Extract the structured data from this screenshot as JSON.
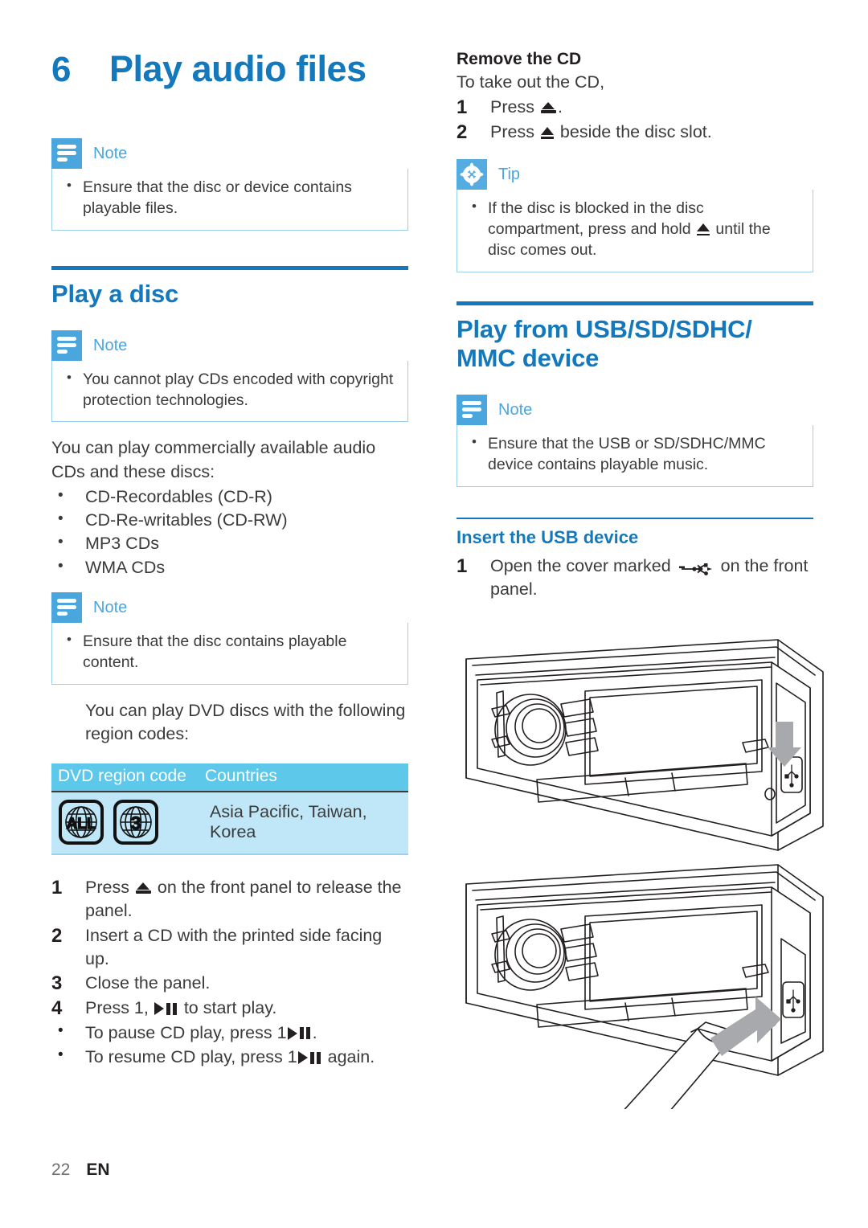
{
  "chapter": {
    "number": "6",
    "title": "Play audio files"
  },
  "left_column": {
    "note_intro": {
      "label": "Note",
      "items": [
        "Ensure that the disc or device contains playable files."
      ]
    },
    "play_a_disc": {
      "title": "Play a disc",
      "note_copyright": {
        "label": "Note",
        "items": [
          "You cannot play CDs encoded with copyright protection technologies."
        ]
      },
      "intro_paragraph": "You can play commercially available audio CDs and these discs:",
      "disc_types": [
        "CD-Recordables (CD-R)",
        "CD-Re-writables (CD-RW)",
        "MP3 CDs",
        "WMA CDs"
      ],
      "note_content": {
        "label": "Note",
        "items": [
          "Ensure that the disc contains playable content."
        ]
      },
      "dvd_paragraph": "You can play DVD discs with the following region codes:",
      "region_table": {
        "headers": [
          "DVD region code",
          "Countries"
        ],
        "rows": [
          {
            "codes": [
              "ALL",
              "3"
            ],
            "countries": "Asia Pacific, Taiwan, Korea"
          }
        ]
      },
      "steps": [
        {
          "num": "1",
          "text_before": "Press ",
          "symbol": "eject-solid",
          "text_after": " on the front panel to release the panel."
        },
        {
          "num": "2",
          "text_before": "Insert a CD with the printed side facing up.",
          "symbol": "",
          "text_after": ""
        },
        {
          "num": "3",
          "text_before": "Close the panel.",
          "symbol": "",
          "text_after": ""
        },
        {
          "num": "4",
          "text_before": "Press 1, ",
          "symbol": "play-pause",
          "text_after": " to start play."
        }
      ],
      "sub_bullets": [
        {
          "text_before": "To pause CD play, press 1",
          "symbol": "play-pause",
          "text_after": "."
        },
        {
          "text_before": "To resume CD play, press 1",
          "symbol": "play-pause",
          "text_after": " again."
        }
      ]
    }
  },
  "right_column": {
    "remove_cd": {
      "heading": "Remove the CD",
      "lead": "To take out the CD,",
      "steps": [
        {
          "num": "1",
          "text_before": "Press ",
          "symbol": "eject-solid",
          "text_after": "."
        },
        {
          "num": "2",
          "text_before": "Press ",
          "symbol": "eject-line",
          "text_after": " beside the disc slot."
        }
      ]
    },
    "tip": {
      "label": "Tip",
      "text_before": "If the disc is blocked in the disc compartment, press and hold ",
      "symbol": "eject-line",
      "text_after": " until the disc comes out."
    },
    "play_from_usb": {
      "title": "Play from USB/SD/SDHC/ MMC device",
      "note": {
        "label": "Note",
        "items": [
          "Ensure that the USB or SD/SDHC/MMC device contains playable music."
        ]
      },
      "insert_usb": {
        "title": "Insert the USB device",
        "steps": [
          {
            "num": "1",
            "text_before": "Open the cover marked ",
            "symbol": "usb",
            "text_after": " on the front panel."
          }
        ]
      }
    }
  },
  "illustration": {
    "alt": "Car stereo front panel: USB cover opened and USB device inserted"
  },
  "footer": {
    "page_number": "22",
    "language": "EN"
  },
  "colors": {
    "heading_blue": "#1379bc",
    "callout_blue": "#4aa6dd",
    "table_header_cyan": "#5ec8ea",
    "table_cell_blue": "#bfe7f7",
    "body_text": "#3b3b3b"
  }
}
